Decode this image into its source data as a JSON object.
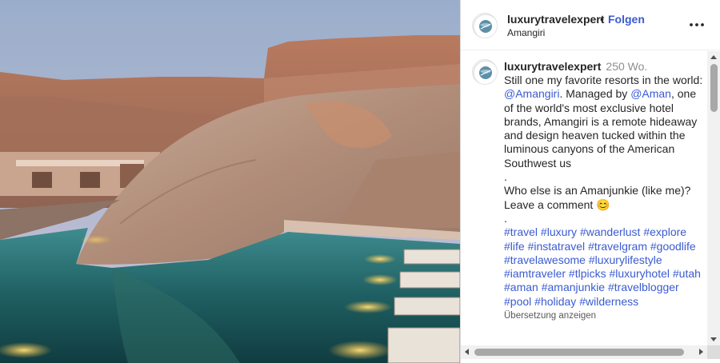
{
  "photo": {
    "subject": "desert-resort-pool-canyon-image"
  },
  "header": {
    "username": "luxurytravelexpert",
    "separator": "•",
    "follow_label": "Folgen",
    "location": "Amangiri",
    "more_icon": "more-options-icon"
  },
  "caption": {
    "username": "luxurytravelexpert",
    "time": "250 Wo.",
    "text_1": "Still one my favorite resorts in the world: ",
    "mention_1": "@Amangiri",
    "text_2": ". Managed by ",
    "mention_2": "@Aman",
    "text_3": ", one of the world's most exclusive hotel brands, Amangiri is a remote hideaway and design heaven tucked within the luminous canyons of the American Southwest us",
    "dot_1": ".",
    "question": "Who else is an Amanjunkie (like me)? Leave a comment ",
    "emoji": "😊",
    "dot_2": ".",
    "hashtags": [
      "#travel",
      "#luxury",
      "#wanderlust",
      "#explore",
      "#life",
      "#instatravel",
      "#travelgram",
      "#goodlife",
      "#travelawesome",
      "#luxurylifestyle",
      "#iamtraveler",
      "#tlpicks",
      "#luxuryhotel",
      "#utah",
      "#aman",
      "#amanjunkie",
      "#travelblogger",
      "#pool",
      "#holiday",
      "#wilderness"
    ],
    "translate_label": "Übersetzung anzeigen"
  },
  "colors": {
    "link": "#3b5bd0",
    "text": "#262626",
    "muted": "#8e8e8e"
  }
}
